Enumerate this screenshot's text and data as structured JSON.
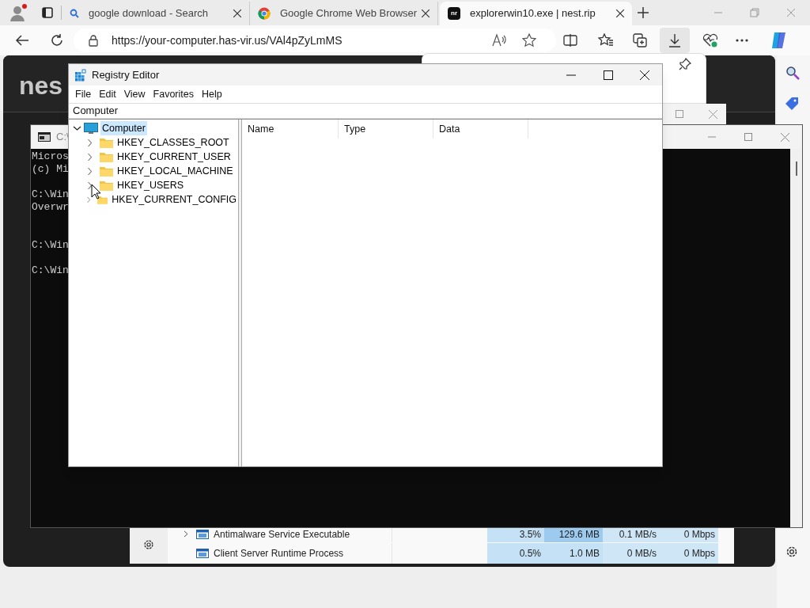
{
  "browser": {
    "tabs": [
      {
        "kind": "search",
        "label": "google download - Search",
        "selected": false
      },
      {
        "kind": "chrome",
        "label": "Google Chrome Web Browser",
        "selected": false
      },
      {
        "kind": "site",
        "icon_text": "nr",
        "label": "explorerwin10.exe | nest.rip",
        "selected": true
      }
    ],
    "address": "https://your-computer.has-vir.us/VAl4pZyLmMS"
  },
  "page": {
    "logo_text": "nes"
  },
  "console": {
    "title": "C:\\",
    "blocks": [
      [
        "Micros",
        "(c) Mi"
      ],
      [
        "C:\\Win",
        "Overwr"
      ],
      [
        "C:\\Win"
      ],
      [
        "C:\\Win"
      ]
    ]
  },
  "task_manager": {
    "rows": [
      {
        "kind": "group",
        "name": "Antimalware Service Executable",
        "cpu": "3.5%",
        "memory": "129.6 MB",
        "disk": "0.1 MB/s",
        "network": "0 Mbps"
      },
      {
        "kind": "process",
        "name": "Client Server Runtime Process",
        "cpu": "0.5%",
        "memory": "1.0 MB",
        "disk": "0 MB/s",
        "network": "0 Mbps"
      }
    ]
  },
  "registry_editor": {
    "title": "Registry Editor",
    "menu": [
      "File",
      "Edit",
      "View",
      "Favorites",
      "Help"
    ],
    "address": "Computer",
    "tree": [
      {
        "label": "Computer",
        "kind": "computer",
        "expanded": true,
        "selected": true,
        "children": [
          {
            "label": "HKEY_CLASSES_ROOT",
            "kind": "folder",
            "expanded": false,
            "selected": false
          },
          {
            "label": "HKEY_CURRENT_USER",
            "kind": "folder",
            "expanded": false,
            "selected": false
          },
          {
            "label": "HKEY_LOCAL_MACHINE",
            "kind": "folder",
            "expanded": false,
            "selected": false
          },
          {
            "label": "HKEY_USERS",
            "kind": "folder",
            "expanded": false,
            "selected": false
          },
          {
            "label": "HKEY_CURRENT_CONFIG",
            "kind": "folder",
            "expanded": false,
            "selected": false
          }
        ]
      }
    ],
    "columns": [
      "Name",
      "Type",
      "Data"
    ]
  }
}
